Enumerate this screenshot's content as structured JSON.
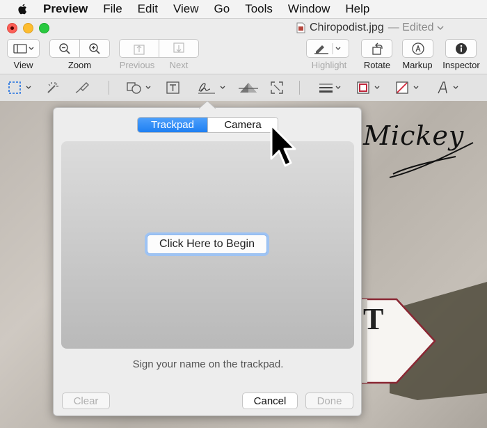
{
  "menubar": {
    "app_name": "Preview",
    "items": [
      "File",
      "Edit",
      "View",
      "Go",
      "Tools",
      "Window",
      "Help"
    ]
  },
  "window": {
    "title": "Chiropodist.jpg",
    "status": "— Edited"
  },
  "toolbar": {
    "view_label": "View",
    "zoom_label": "Zoom",
    "previous_label": "Previous",
    "next_label": "Next",
    "highlight_label": "Highlight",
    "rotate_label": "Rotate",
    "markup_label": "Markup",
    "inspector_label": "Inspector"
  },
  "photo": {
    "signature_text": "Mickey",
    "sign_letter": "T"
  },
  "signature_panel": {
    "tabs": [
      {
        "label": "Trackpad",
        "selected": true
      },
      {
        "label": "Camera",
        "selected": false
      }
    ],
    "begin_button": "Click Here to Begin",
    "hint": "Sign your name on the trackpad.",
    "clear_button": "Clear",
    "cancel_button": "Cancel",
    "done_button": "Done"
  },
  "icons": [
    "apple-icon",
    "sidebar-icon",
    "zoom-out-icon",
    "zoom-in-icon",
    "previous-icon",
    "next-icon",
    "highlight-icon",
    "rotate-icon",
    "markup-icon",
    "inspector-icon",
    "rect-select-icon",
    "instant-alpha-icon",
    "sketch-icon",
    "shapes-icon",
    "text-icon",
    "signature-icon",
    "adjust-color-icon",
    "adjust-size-icon",
    "line-style-icon",
    "border-color-icon",
    "fill-color-icon",
    "font-icon",
    "mouse-cursor-icon"
  ],
  "colors": {
    "accent": "#1e7ff2",
    "close": "#fc5f57",
    "minimize": "#fdbc2e",
    "maximize": "#29c940"
  }
}
